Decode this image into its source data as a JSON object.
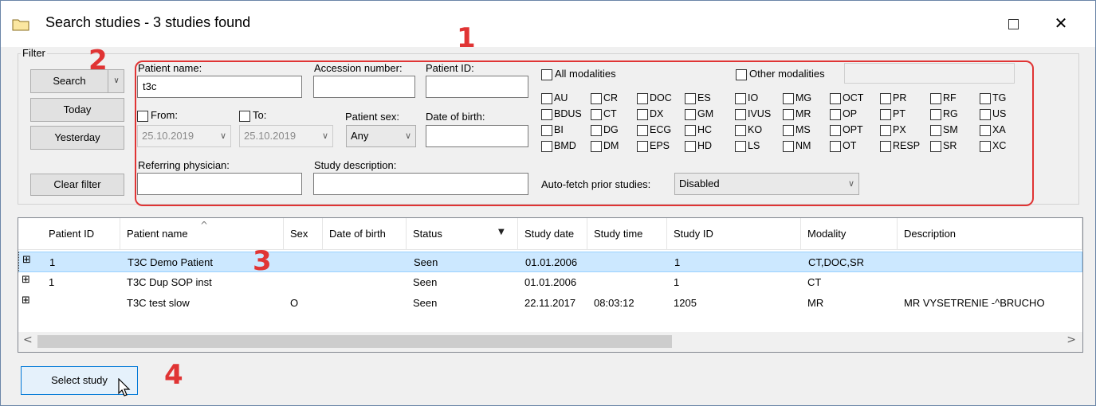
{
  "window": {
    "title": "Search studies - 3 studies found",
    "maximize_icon": "maximize-icon",
    "close_label": "✕"
  },
  "filter": {
    "legend": "Filter",
    "buttons": {
      "search": "Search",
      "today": "Today",
      "yesterday": "Yesterday",
      "clear": "Clear filter"
    },
    "patient_name_label": "Patient name:",
    "patient_name_value": "t3c",
    "accession_label": "Accession number:",
    "accession_value": "",
    "patient_id_label": "Patient ID:",
    "patient_id_value": "",
    "from_label": "From:",
    "from_value": "25.10.2019",
    "to_label": "To:",
    "to_value": "25.10.2019",
    "patient_sex_label": "Patient sex:",
    "patient_sex_value": "Any",
    "dob_label": "Date of birth:",
    "dob_value": "",
    "referring_label": "Referring physician:",
    "referring_value": "",
    "study_desc_label": "Study description:",
    "study_desc_value": "",
    "all_modalities_label": "All modalities",
    "other_modalities_label": "Other modalities",
    "other_modalities_value": "",
    "modalities": [
      [
        "AU",
        "CR",
        "DOC",
        "ES",
        "IO",
        "MG",
        "OCT",
        "PR",
        "RF",
        "TG"
      ],
      [
        "BDUS",
        "CT",
        "DX",
        "GM",
        "IVUS",
        "MR",
        "OP",
        "PT",
        "RG",
        "US"
      ],
      [
        "BI",
        "DG",
        "ECG",
        "HC",
        "KO",
        "MS",
        "OPT",
        "PX",
        "SM",
        "XA"
      ],
      [
        "BMD",
        "DM",
        "EPS",
        "HD",
        "LS",
        "NM",
        "OT",
        "RESP",
        "SR",
        "XC"
      ]
    ],
    "auto_fetch_label": "Auto-fetch prior studies:",
    "auto_fetch_value": "Disabled"
  },
  "results": {
    "columns": [
      "Patient ID",
      "Patient name",
      "Sex",
      "Date of birth",
      "Status",
      "Study date",
      "Study time",
      "Study ID",
      "Modality",
      "Description"
    ],
    "rows": [
      {
        "patient_id": "1",
        "patient_name": "T3C Demo Patient",
        "sex": "",
        "dob": "",
        "status": "Seen",
        "study_date": "01.01.2006",
        "study_time": "",
        "study_id": "1",
        "modality": "CT,DOC,SR",
        "description": "",
        "selected": true
      },
      {
        "patient_id": "1",
        "patient_name": "T3C Dup SOP inst",
        "sex": "",
        "dob": "",
        "status": "Seen",
        "study_date": "01.01.2006",
        "study_time": "",
        "study_id": "1",
        "modality": "CT",
        "description": "",
        "selected": false
      },
      {
        "patient_id": "",
        "patient_name": "T3C  test  slow",
        "sex": "O",
        "dob": "",
        "status": "Seen",
        "study_date": "22.11.2017",
        "study_time": "08:03:12",
        "study_id": "1205",
        "modality": "MR",
        "description": "MR VYSETRENIE -^BRUCHO",
        "selected": false
      }
    ],
    "expand_glyph": "⊞"
  },
  "footer": {
    "select_button": "Select study"
  },
  "callouts": [
    "1",
    "2",
    "3",
    "4"
  ],
  "colors": {
    "annotation_red": "#e03434",
    "selection": "#cce8ff",
    "button_face": "#e1e1e1"
  }
}
